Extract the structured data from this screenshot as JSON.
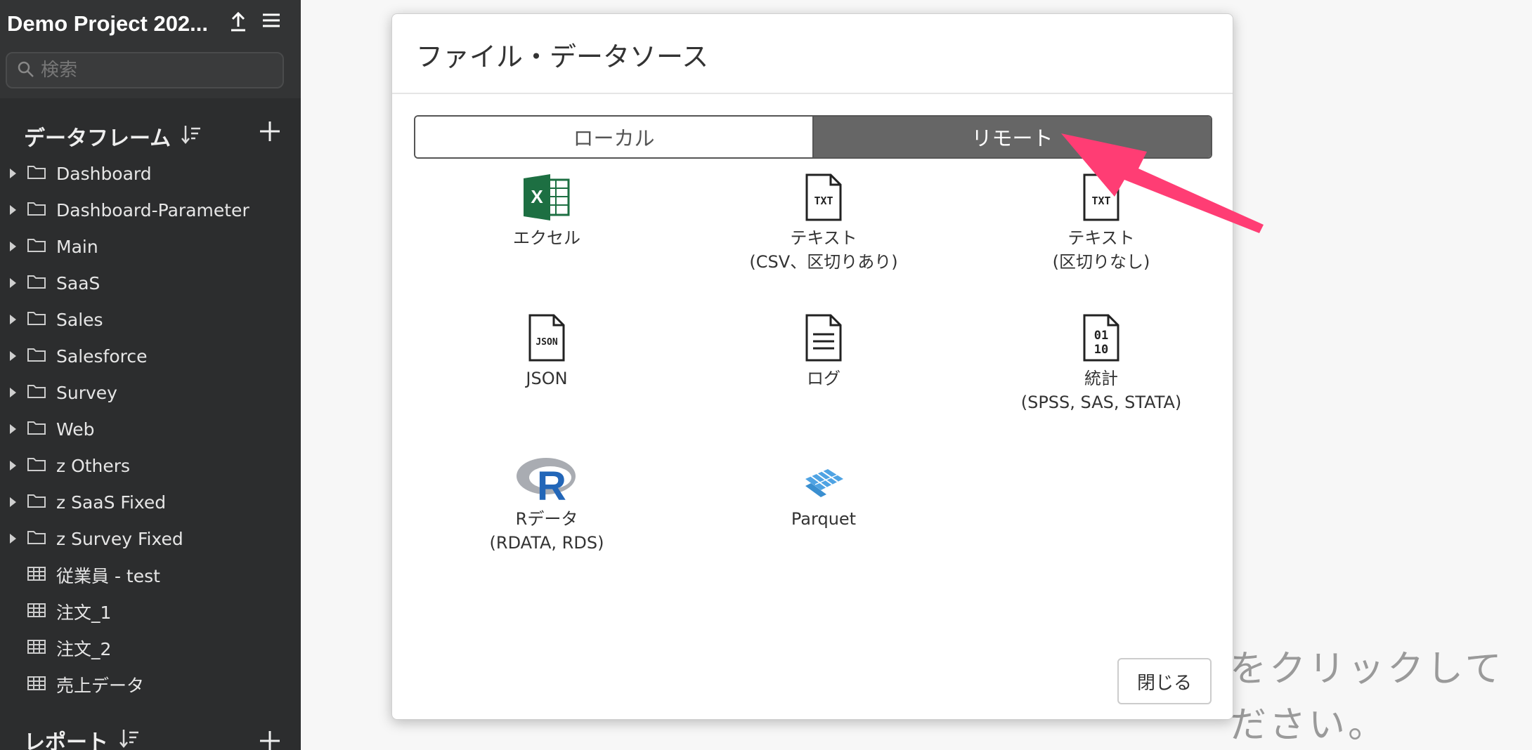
{
  "sidebar": {
    "project_title": "Demo Project 202...",
    "upload_icon": "upload-icon",
    "menu_icon": "hamburger-menu-icon",
    "search_placeholder": "検索",
    "dataframes_header": "データフレーム",
    "reports_header": "レポート",
    "folders": [
      "Dashboard",
      "Dashboard-Parameter",
      "Main",
      "SaaS",
      "Sales",
      "Salesforce",
      "Survey",
      "Web",
      "z Others",
      "z SaaS Fixed",
      "z Survey Fixed"
    ],
    "tables": [
      "従業員 - test",
      "注文_1",
      "注文_2",
      "売上データ"
    ]
  },
  "background_hint": {
    "line1": "をクリックして",
    "line2": "ださい。"
  },
  "modal": {
    "title": "ファイル・データソース",
    "tabs": {
      "local": "ローカル",
      "remote": "リモート",
      "active": "remote"
    },
    "sources": [
      {
        "icon": "excel-icon",
        "line1": "エクセル",
        "line2": ""
      },
      {
        "icon": "txt-file-icon",
        "line1": "テキスト",
        "line2": "(CSV、区切りあり)"
      },
      {
        "icon": "txt-file-icon",
        "line1": "テキスト",
        "line2": "(区切りなし)"
      },
      {
        "icon": "json-file-icon",
        "line1": "JSON",
        "line2": ""
      },
      {
        "icon": "log-file-icon",
        "line1": "ログ",
        "line2": ""
      },
      {
        "icon": "binary-file-icon",
        "line1": "統計",
        "line2": "(SPSS, SAS, STATA)"
      },
      {
        "icon": "r-logo-icon",
        "line1": "Rデータ",
        "line2": "(RDATA, RDS)"
      },
      {
        "icon": "parquet-icon",
        "line1": "Parquet",
        "line2": ""
      }
    ],
    "close_label": "閉じる"
  },
  "colors": {
    "sidebar_bg": "#2c2d2e",
    "active_tab": "#666666",
    "arrow": "#ff3d74"
  }
}
